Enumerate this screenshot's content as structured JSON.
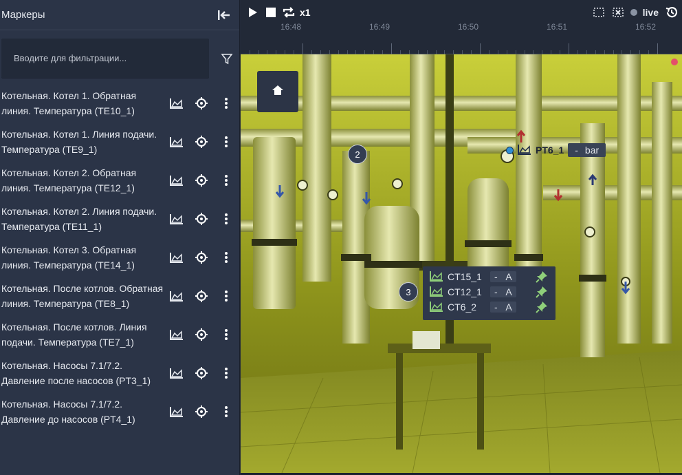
{
  "sidebar": {
    "title": "Маркеры",
    "filter_placeholder": "Вводите для фильтрации...",
    "items": [
      {
        "label": "Котельная. Котел 1. Обратная линия. Температура (TE10_1)"
      },
      {
        "label": "Котельная. Котел 1. Линия подачи. Температура (TE9_1)"
      },
      {
        "label": "Котельная. Котел 2. Обратная линия. Температура (TE12_1)"
      },
      {
        "label": "Котельная. Котел 2. Линия подачи. Температура (TE11_1)"
      },
      {
        "label": "Котельная. Котел 3. Обратная линия. Температура (TE14_1)"
      },
      {
        "label": "Котельная. После котлов. Обратная линия. Температура (TE8_1)"
      },
      {
        "label": "Котельная. После котлов. Линия подачи. Температура (TE7_1)"
      },
      {
        "label": "Котельная. Насосы 7.1/7.2. Давление после насосов (PT3_1)"
      },
      {
        "label": "Котельная. Насосы 7.1/7.2. Давление до насосов (PT4_1)"
      }
    ]
  },
  "toolbar": {
    "speed": "x1",
    "live_label": "live"
  },
  "timeline": {
    "ticks": [
      "16:48",
      "16:49",
      "16:50",
      "16:51",
      "16:52"
    ]
  },
  "scene": {
    "badges": [
      "2",
      "3"
    ],
    "tag_single": {
      "name": "PT6_1",
      "separator": "-",
      "unit": "bar"
    },
    "tag_group": [
      {
        "name": "CT15_1",
        "separator": "-",
        "unit": "A"
      },
      {
        "name": "CT12_1",
        "separator": "-",
        "unit": "A"
      },
      {
        "name": "CT6_2",
        "separator": "-",
        "unit": "A"
      }
    ]
  },
  "colors": {
    "sidebar_bg": "#2b3447",
    "topbar_bg": "#222937",
    "accent_green": "#8fcf7a",
    "live_indicator": "#e4506a"
  },
  "icons": [
    "collapse-icon",
    "filter-icon",
    "area-chart-icon",
    "crosshair-icon",
    "more-vert-icon",
    "play-icon",
    "stop-icon",
    "repeat-icon",
    "select-area-icon",
    "clear-selection-icon",
    "history-icon",
    "home-icon",
    "pin-icon"
  ]
}
